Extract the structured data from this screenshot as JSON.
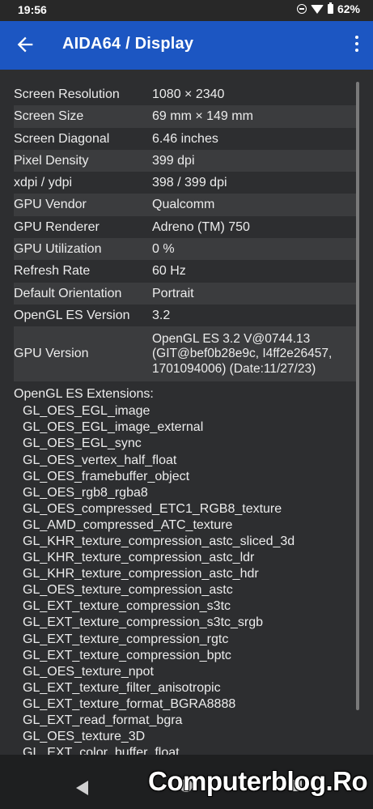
{
  "status_bar": {
    "time": "19:56",
    "battery": "62%",
    "icons": [
      "dnd-icon",
      "wifi-icon",
      "battery-icon"
    ]
  },
  "app_bar": {
    "title": "AIDA64  /  Display",
    "color": "#1c56c2"
  },
  "rows": [
    {
      "key": "Screen Resolution",
      "value": "1080 × 2340"
    },
    {
      "key": "Screen Size",
      "value": "69 mm × 149 mm"
    },
    {
      "key": "Screen Diagonal",
      "value": "6.46 inches"
    },
    {
      "key": "Pixel Density",
      "value": "399 dpi"
    },
    {
      "key": "xdpi / ydpi",
      "value": "398 / 399 dpi"
    },
    {
      "key": "GPU Vendor",
      "value": "Qualcomm"
    },
    {
      "key": "GPU Renderer",
      "value": "Adreno (TM) 750"
    },
    {
      "key": "GPU Utilization",
      "value": "0 %"
    },
    {
      "key": "Refresh Rate",
      "value": "60 Hz"
    },
    {
      "key": "Default Orientation",
      "value": "Portrait"
    },
    {
      "key": "OpenGL ES Version",
      "value": "3.2"
    },
    {
      "key": "GPU Version",
      "value": "OpenGL ES 3.2 V@0744.13 (GIT@bef0b28e9c, I4ff2e26457, 1701094006) (Date:11/27/23)"
    }
  ],
  "extensions": {
    "title": "OpenGL ES Extensions:",
    "items": [
      "GL_OES_EGL_image",
      "GL_OES_EGL_image_external",
      "GL_OES_EGL_sync",
      "GL_OES_vertex_half_float",
      "GL_OES_framebuffer_object",
      "GL_OES_rgb8_rgba8",
      "GL_OES_compressed_ETC1_RGB8_texture",
      "GL_AMD_compressed_ATC_texture",
      "GL_KHR_texture_compression_astc_sliced_3d",
      "GL_KHR_texture_compression_astc_ldr",
      "GL_KHR_texture_compression_astc_hdr",
      "GL_OES_texture_compression_astc",
      "GL_EXT_texture_compression_s3tc",
      "GL_EXT_texture_compression_s3tc_srgb",
      "GL_EXT_texture_compression_rgtc",
      "GL_EXT_texture_compression_bptc",
      "GL_OES_texture_npot",
      "GL_EXT_texture_filter_anisotropic",
      "GL_EXT_texture_format_BGRA8888",
      "GL_EXT_read_format_bgra",
      "GL_OES_texture_3D",
      "GL_EXT_color_buffer_float"
    ]
  },
  "watermark": "Computerblog.Ro"
}
